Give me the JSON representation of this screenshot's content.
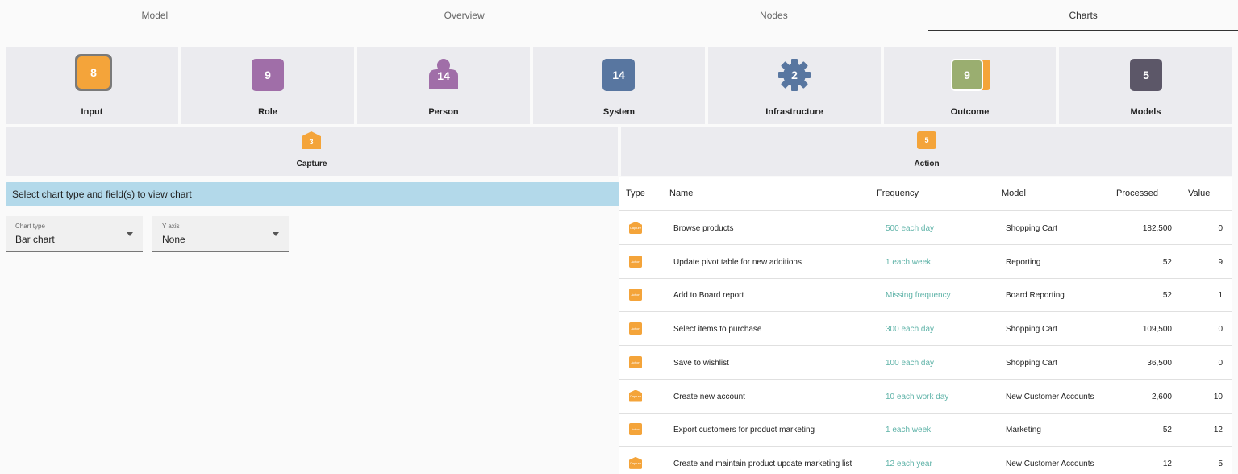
{
  "tabs": [
    "Model",
    "Overview",
    "Nodes",
    "Charts"
  ],
  "tiles": {
    "input": {
      "label": "Input",
      "count": "8",
      "color": "#f4a43a"
    },
    "role": {
      "label": "Role",
      "count": "9",
      "color": "#a06ea8"
    },
    "person": {
      "label": "Person",
      "count": "14",
      "color": "#a06ea8"
    },
    "system": {
      "label": "System",
      "count": "14",
      "color": "#5876a0"
    },
    "infrastructure": {
      "label": "Infrastructure",
      "count": "2",
      "color": "#5876a0"
    },
    "outcome": {
      "label": "Outcome",
      "count": "9",
      "color": "#9aae70"
    },
    "models": {
      "label": "Models",
      "count": "5",
      "color": "#5c5768"
    },
    "capture": {
      "label": "Capture",
      "count": "3",
      "color": "#f4a43a"
    },
    "action": {
      "label": "Action",
      "count": "5",
      "color": "#f4a43a"
    }
  },
  "info": "Select chart type and field(s) to view chart",
  "chart_type": {
    "label": "Chart type",
    "value": "Bar chart"
  },
  "y_axis": {
    "label": "Y axis",
    "value": "None"
  },
  "table": {
    "headers": {
      "type": "Type",
      "name": "Name",
      "frequency": "Frequency",
      "model": "Model",
      "processed": "Processed",
      "value": "Value"
    },
    "rows": [
      {
        "type": "Capture",
        "name": "Browse products",
        "frequency": "500 each day",
        "model": "Shopping Cart",
        "processed": "182,500",
        "value": "0"
      },
      {
        "type": "Action",
        "name": "Update pivot table for new additions",
        "frequency": "1 each week",
        "model": "Reporting",
        "processed": "52",
        "value": "9"
      },
      {
        "type": "Action",
        "name": "Add to Board report",
        "frequency": "Missing frequency",
        "model": "Board Reporting",
        "processed": "52",
        "value": "1"
      },
      {
        "type": "Action",
        "name": "Select items to purchase",
        "frequency": "300 each day",
        "model": "Shopping Cart",
        "processed": "109,500",
        "value": "0"
      },
      {
        "type": "Action",
        "name": "Save to wishlist",
        "frequency": "100 each day",
        "model": "Shopping Cart",
        "processed": "36,500",
        "value": "0"
      },
      {
        "type": "Capture",
        "name": "Create new account",
        "frequency": "10 each work day",
        "model": "New Customer Accounts",
        "processed": "2,600",
        "value": "10"
      },
      {
        "type": "Action",
        "name": "Export customers for product marketing",
        "frequency": "1 each week",
        "model": "Marketing",
        "processed": "52",
        "value": "12"
      },
      {
        "type": "Capture",
        "name": "Create and maintain product update marketing list",
        "frequency": "12 each year",
        "model": "New Customer Accounts",
        "processed": "12",
        "value": "5"
      }
    ]
  }
}
